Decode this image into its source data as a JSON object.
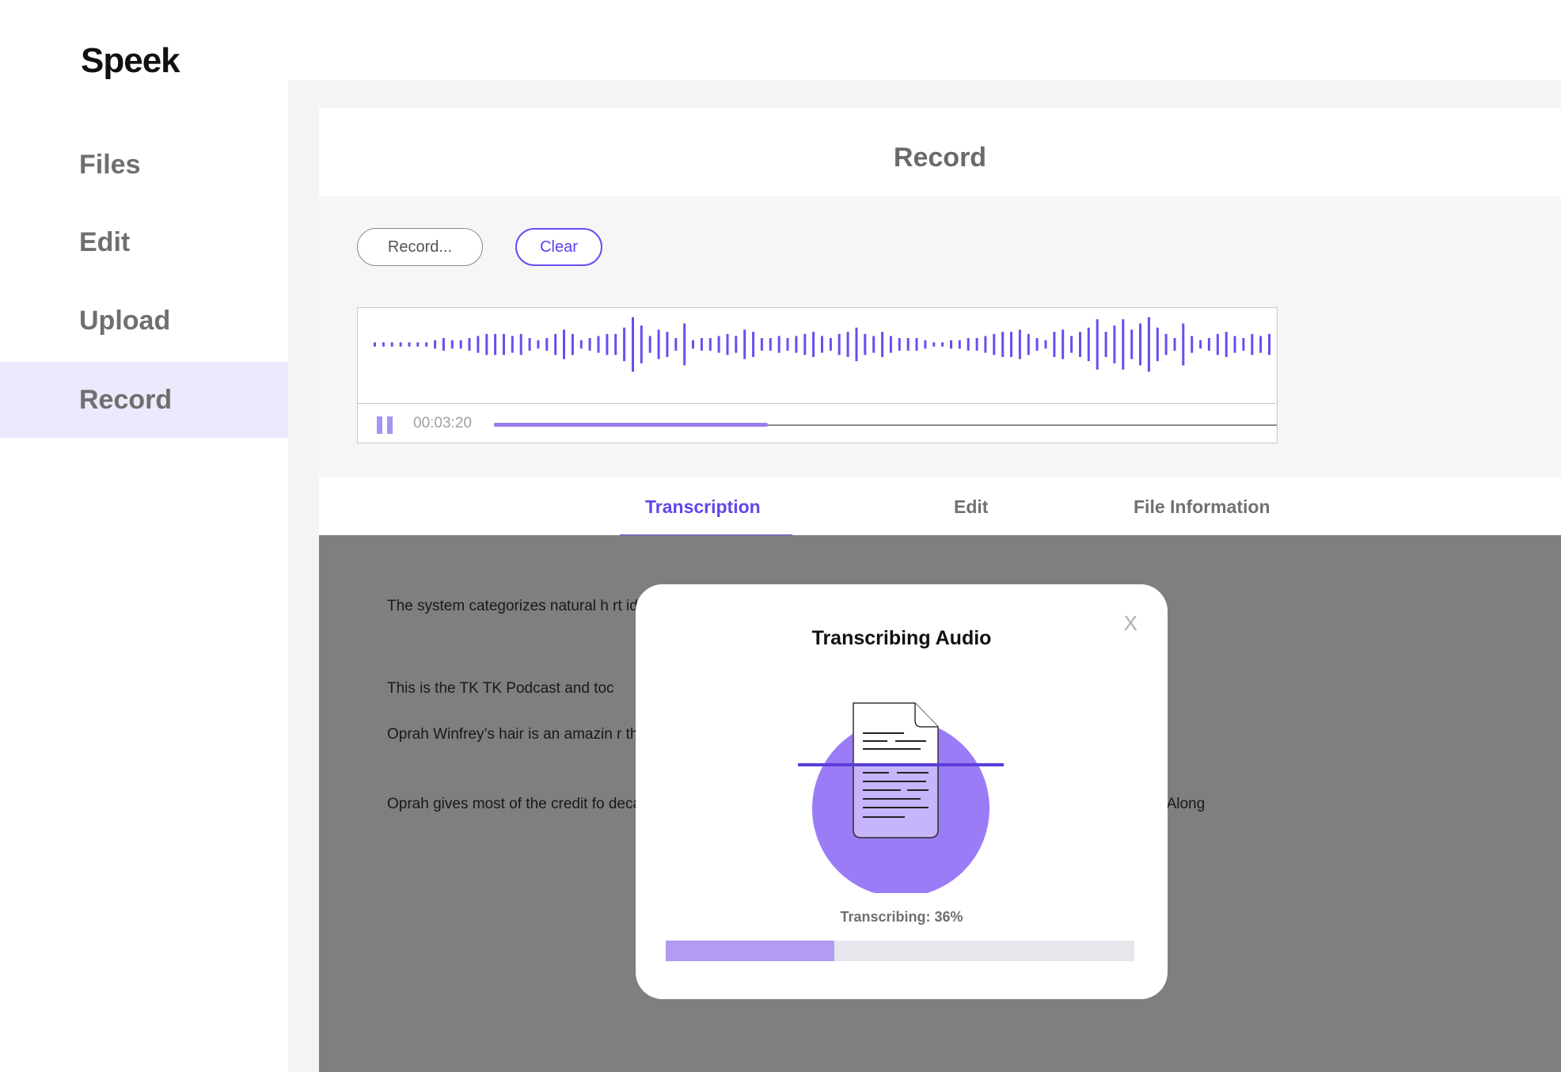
{
  "app": {
    "logo": "Speek"
  },
  "sidebar": {
    "items": [
      {
        "label": "Files",
        "active": false
      },
      {
        "label": "Edit",
        "active": false
      },
      {
        "label": "Upload",
        "active": false
      },
      {
        "label": "Record",
        "active": true
      }
    ]
  },
  "panel": {
    "title": "Record",
    "record_button": "Record...",
    "clear_button": "Clear"
  },
  "player": {
    "time": "00:03:20",
    "progress_fraction": 0.35,
    "wave_color": "#6a4df0"
  },
  "tabs": [
    {
      "label": "Transcription",
      "active": true
    },
    {
      "label": "Edit",
      "active": false
    },
    {
      "label": "File Information",
      "active": false
    }
  ],
  "document": {
    "paragraphs": [
      "The system categorizes natural h                                                                                         rt identifies four hair types and within each of those categories there are differ",
      "This is the TK TK Podcast and toc",
      "Oprah Winfrey’s hair is an amazin                                                                                         r the years, including weaves and braids. She                                                                                    en her hair.",
      "Oprah gives most of the credit fo                                                                                         decades. Walker first met Oprah back in th                                                                                   ost important media figures in the world. Along"
    ]
  },
  "modal": {
    "title": "Transcribing Audio",
    "close": "X",
    "progress_label": "Transcribing: 36%",
    "progress_fraction": 0.36
  },
  "colors": {
    "accent": "#6a4df0",
    "accent_light": "#b19bf3",
    "active_nav_bg": "#ebe9fc"
  }
}
